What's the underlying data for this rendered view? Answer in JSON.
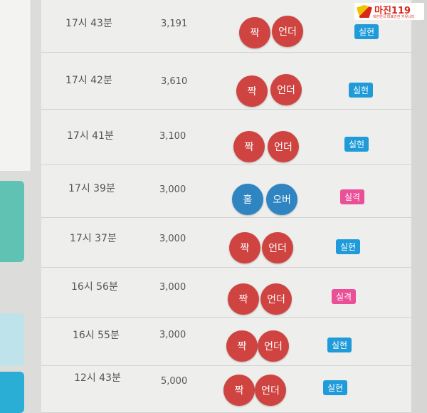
{
  "logo": {
    "text": "마진119",
    "sub": "대한민국 대표안전 커뮤니티"
  },
  "rows": [
    {
      "time": "17시 43분",
      "amount": "3,191",
      "ball1": "짝",
      "ball2": "언더",
      "result": "실현",
      "tone": "red",
      "status": "hit"
    },
    {
      "time": "17시 42분",
      "amount": "3,610",
      "ball1": "짝",
      "ball2": "언더",
      "result": "실현",
      "tone": "red",
      "status": "hit"
    },
    {
      "time": "17시 41분",
      "amount": "3,100",
      "ball1": "짝",
      "ball2": "언더",
      "result": "실현",
      "tone": "red",
      "status": "hit"
    },
    {
      "time": "17시 39분",
      "amount": "3,000",
      "ball1": "홀",
      "ball2": "오버",
      "result": "실격",
      "tone": "blue",
      "status": "miss"
    },
    {
      "time": "17시 37분",
      "amount": "3,000",
      "ball1": "짝",
      "ball2": "언더",
      "result": "실현",
      "tone": "red",
      "status": "hit"
    },
    {
      "time": "16시 56분",
      "amount": "3,000",
      "ball1": "짝",
      "ball2": "언더",
      "result": "실격",
      "tone": "red",
      "status": "miss"
    },
    {
      "time": "16시 55분",
      "amount": "3,000",
      "ball1": "짝",
      "ball2": "언더",
      "result": "실현",
      "tone": "red",
      "status": "hit"
    },
    {
      "time": "12시 43분",
      "amount": "5,000",
      "ball1": "짝",
      "ball2": "언더",
      "result": "실현",
      "tone": "red",
      "status": "hit"
    }
  ],
  "colors": {
    "red": "#cf4440",
    "blue": "#2f84c2",
    "hit": "#1f9bd9",
    "miss": "#ea4f97"
  }
}
